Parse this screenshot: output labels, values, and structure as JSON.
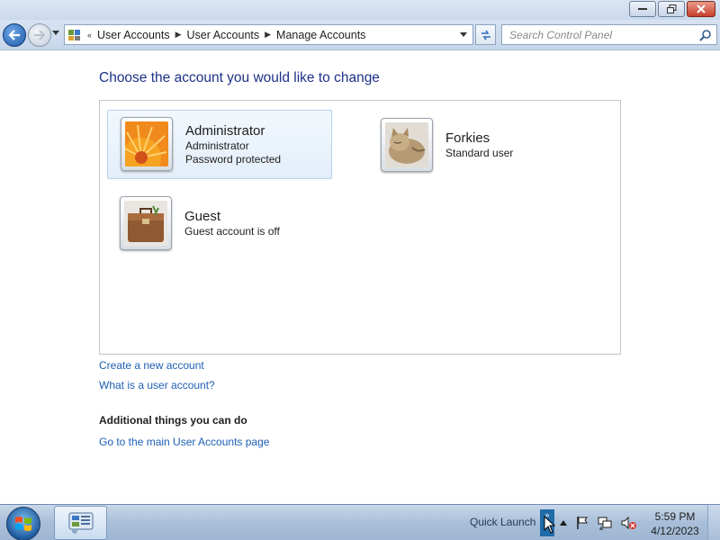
{
  "window": {
    "controls": {
      "minimize": "minimize-icon",
      "restore": "restore-icon",
      "close": "close-icon"
    }
  },
  "nav": {
    "breadcrumb": [
      "User Accounts",
      "User Accounts",
      "Manage Accounts"
    ],
    "overflow": "«",
    "search_placeholder": "Search Control Panel"
  },
  "main": {
    "title": "Choose the account you would like to change",
    "accounts": [
      {
        "name": "Administrator",
        "lines": [
          "Administrator",
          "Password protected"
        ],
        "picture": "flower",
        "selected": true
      },
      {
        "name": "Forkies",
        "lines": [
          "Standard user"
        ],
        "picture": "kitten",
        "selected": false
      },
      {
        "name": "Guest",
        "lines": [
          "Guest account is off"
        ],
        "picture": "briefcase",
        "selected": false
      }
    ],
    "links": {
      "create": "Create a new account",
      "what_is": "What is a user account?"
    },
    "additional": {
      "heading": "Additional things you can do",
      "main_page_link": "Go to the main User Accounts page"
    }
  },
  "taskbar": {
    "quick_launch": "Quick Launch",
    "chevron": "»",
    "time": "5:59 PM",
    "date": "4/12/2023"
  },
  "colors": {
    "link": "#1d5fb5",
    "title": "#1e3287",
    "selection_bg": "#e4eef9"
  }
}
